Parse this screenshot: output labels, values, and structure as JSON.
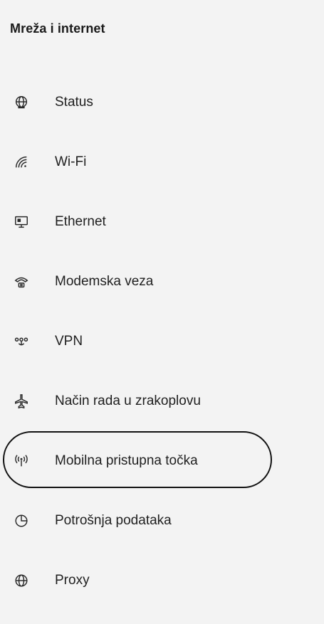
{
  "panel": {
    "title": "Mreža i internet"
  },
  "nav": {
    "items": [
      {
        "label": "Status",
        "icon": "globe-status-icon"
      },
      {
        "label": "Wi-Fi",
        "icon": "wifi-icon"
      },
      {
        "label": "Ethernet",
        "icon": "ethernet-icon"
      },
      {
        "label": "Modemska veza",
        "icon": "dialup-phone-icon"
      },
      {
        "label": "VPN",
        "icon": "vpn-icon"
      },
      {
        "label": "Način rada u zrakoplovu",
        "icon": "airplane-icon"
      },
      {
        "label": "Mobilna pristupna točka",
        "icon": "hotspot-icon"
      },
      {
        "label": "Potrošnja podataka",
        "icon": "data-usage-icon"
      },
      {
        "label": "Proxy",
        "icon": "globe-proxy-icon"
      }
    ]
  },
  "colors": {
    "background": "#f3f3f3",
    "text": "#1f1f1f",
    "highlight_ring": "#111111"
  }
}
